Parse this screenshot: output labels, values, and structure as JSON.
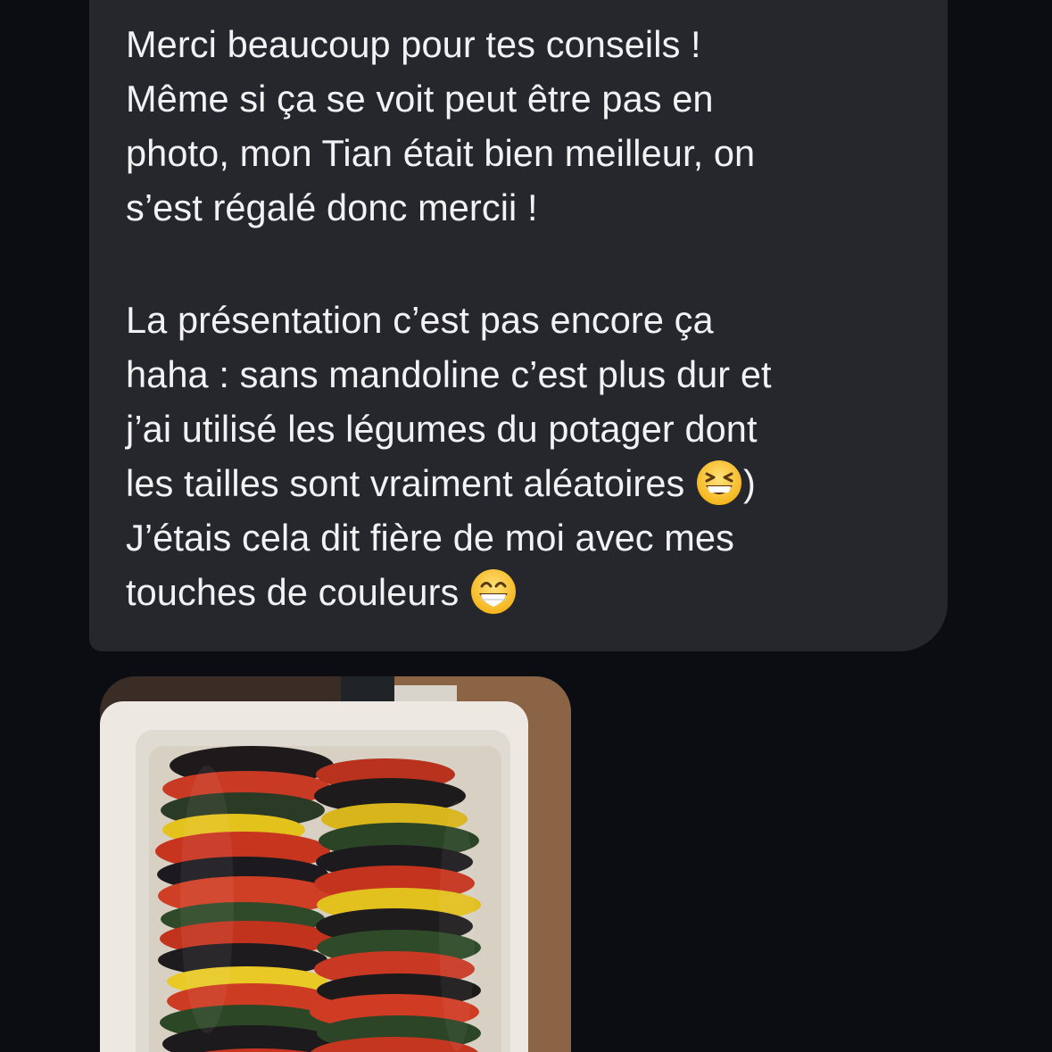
{
  "message": {
    "lines": [
      "Merci beaucoup pour tes conseils !",
      "Même si ça se voit peut être pas en",
      "photo, mon Tian était bien meilleur, on",
      "s’est régalé donc mercii !",
      "La présentation c’est pas encore ça",
      "haha : sans mandoline c’est plus dur et",
      "j’ai utilisé les légumes du potager dont",
      "les tailles sont vraiment aléatoires",
      ")",
      "J’étais cela dit fière de moi avec mes",
      "touches de couleurs"
    ],
    "emojis": [
      "grinning-squinting-face-icon",
      "beaming-face-icon"
    ]
  },
  "colors": {
    "background": "#0b0d12",
    "bubble": "#25272c",
    "text": "#f2f2f4"
  },
  "attachment": {
    "type": "photo",
    "subject": "tian of tomato, zucchini, eggplant and yellow squash slices in a white baking dish"
  }
}
